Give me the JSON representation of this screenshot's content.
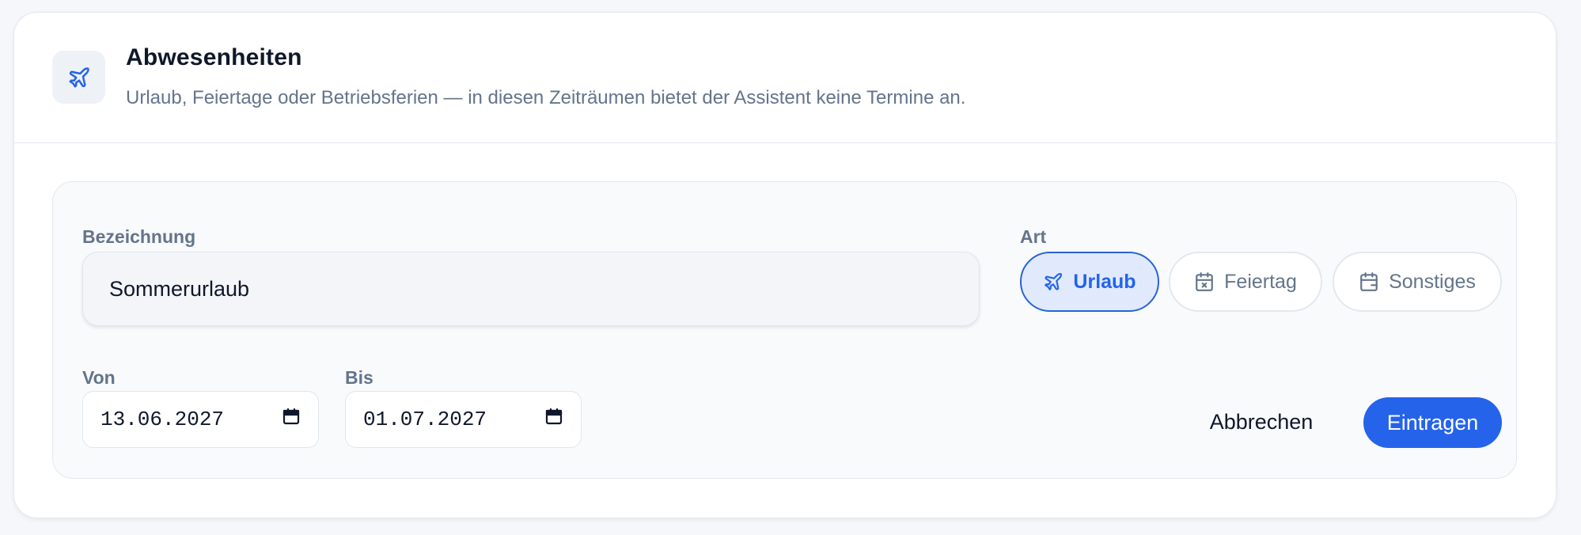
{
  "header": {
    "icon": "plane-icon",
    "title": "Abwesenheiten",
    "subtitle": "Urlaub, Feiertage oder Betriebsferien — in diesen Zeiträumen bietet der Assistent keine Termine an."
  },
  "form": {
    "name_label": "Bezeichnung",
    "name_value": "Sommerurlaub",
    "type_label": "Art",
    "types": [
      {
        "label": "Urlaub",
        "icon": "plane-icon",
        "selected": true
      },
      {
        "label": "Feiertag",
        "icon": "calendar-x-icon",
        "selected": false
      },
      {
        "label": "Sonstiges",
        "icon": "calendar-minus-icon",
        "selected": false
      }
    ],
    "from_label": "Von",
    "from_value": "13.06.2027",
    "to_label": "Bis",
    "to_value": "01.07.2027",
    "cancel_label": "Abbrechen",
    "submit_label": "Eintragen"
  },
  "colors": {
    "accent": "#2563eb",
    "accent_bg": "#e0eafc",
    "muted_text": "#64748b"
  }
}
